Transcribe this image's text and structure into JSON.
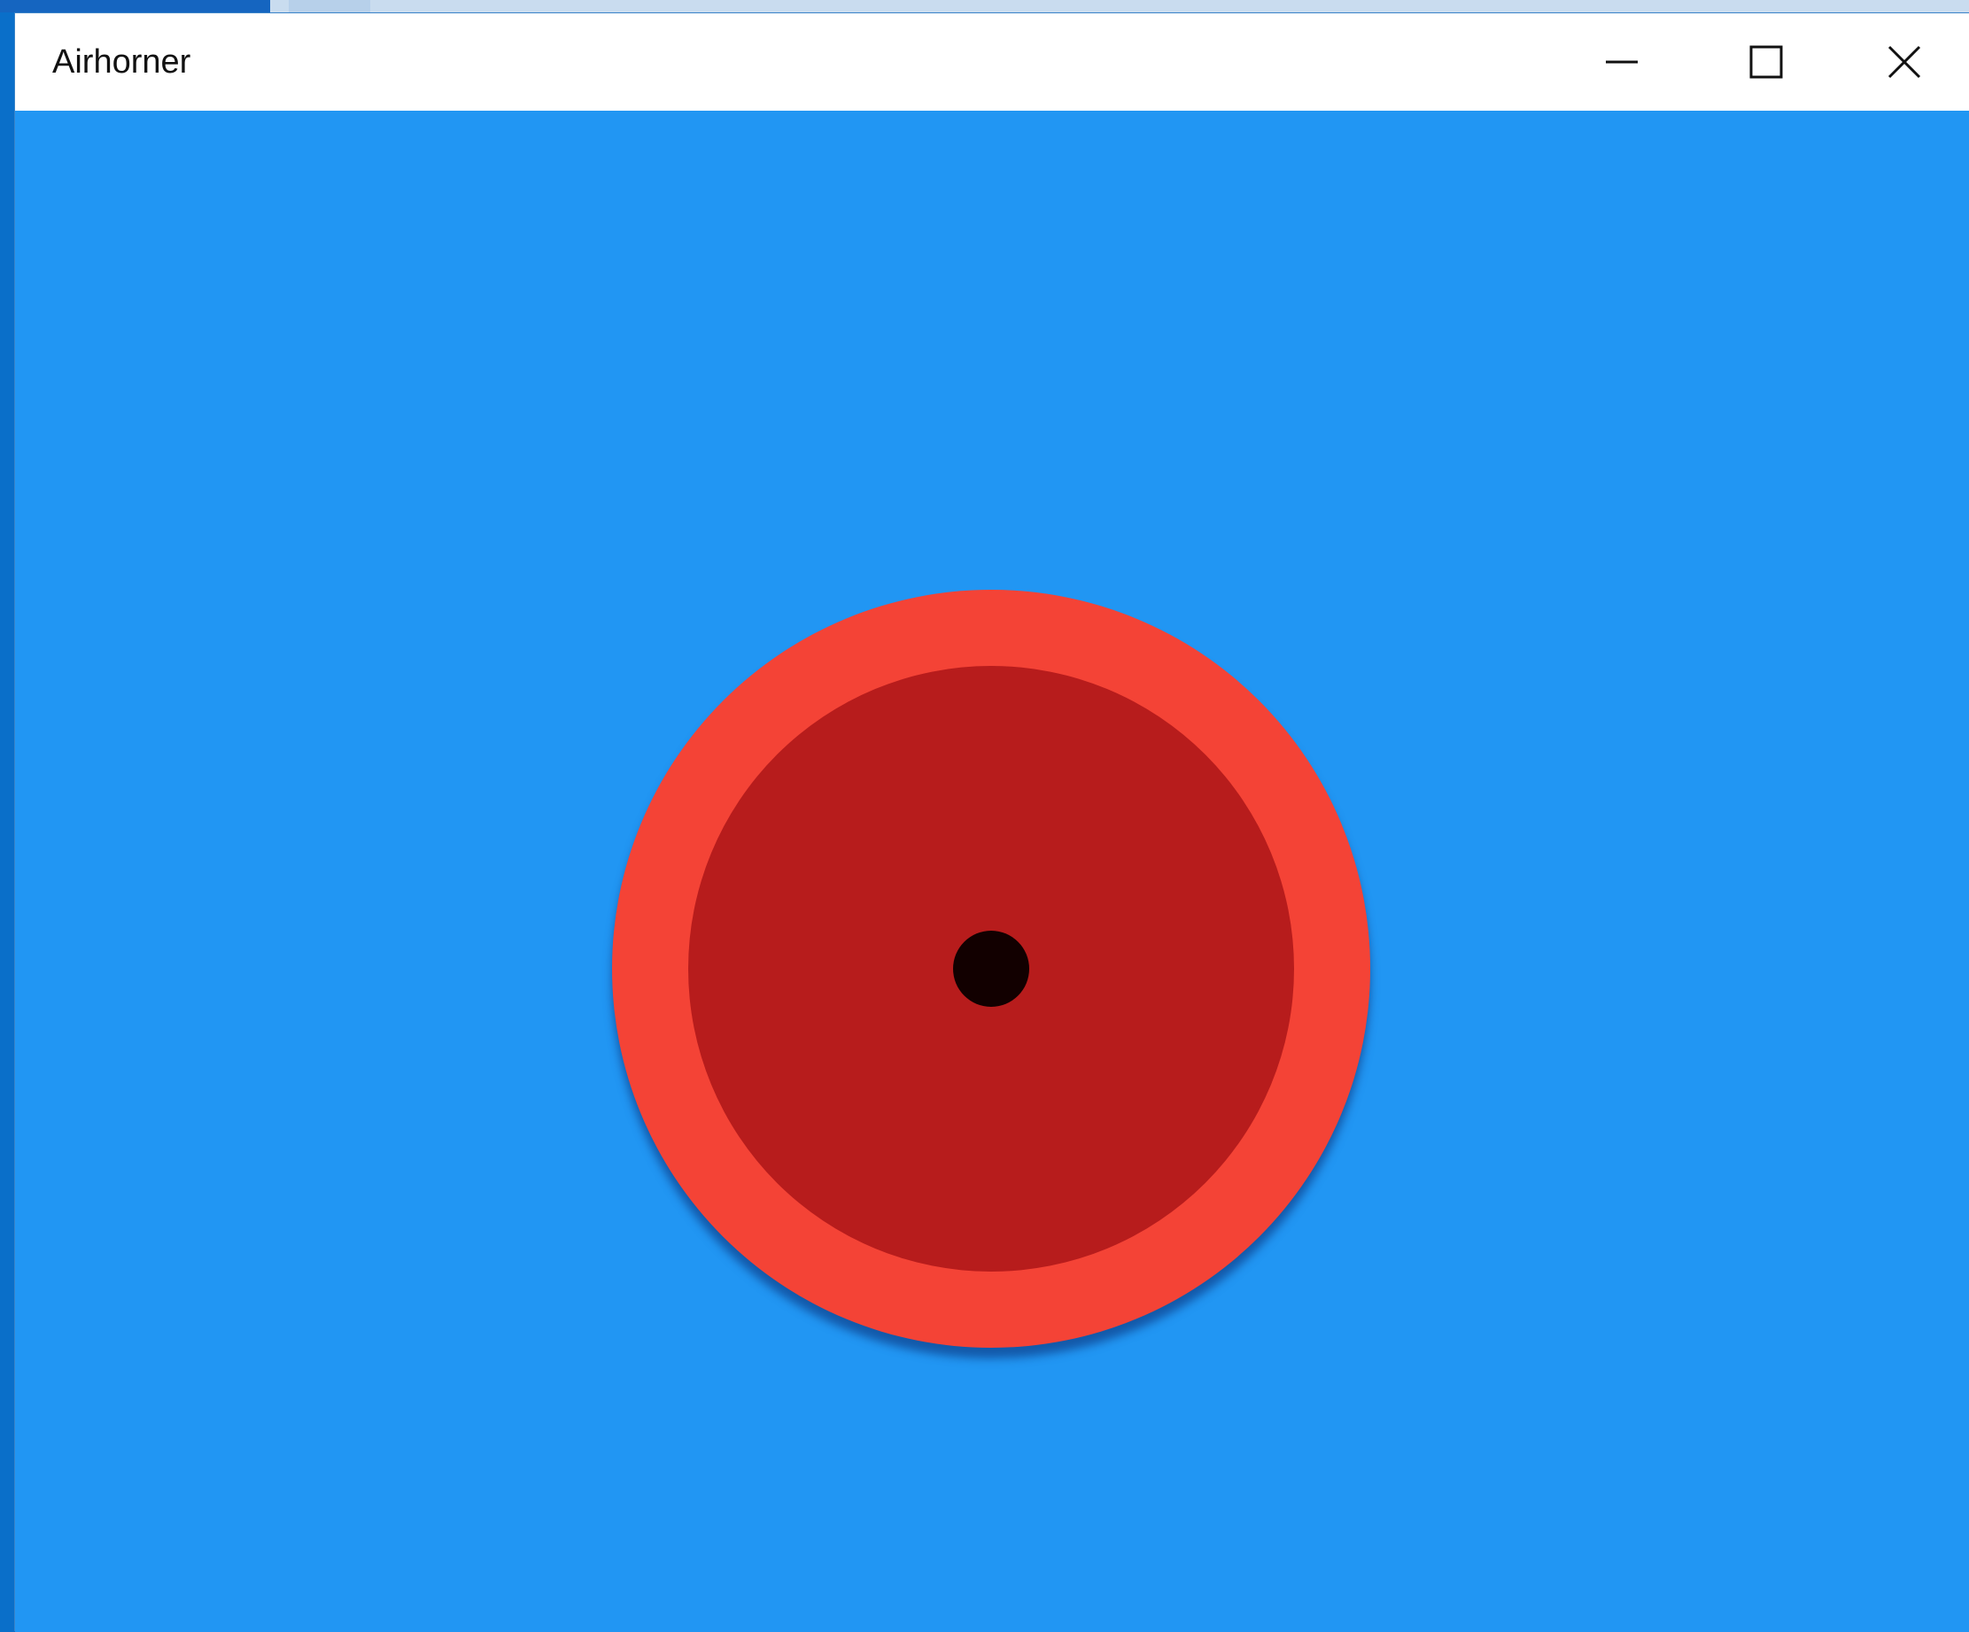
{
  "window": {
    "title": "Airhorner"
  },
  "titlebar": {
    "buttons": [
      {
        "name": "minimize",
        "icon": "minimize-icon"
      },
      {
        "name": "maximize",
        "icon": "maximize-icon"
      },
      {
        "name": "close",
        "icon": "close-icon"
      }
    ]
  },
  "colors": {
    "background": "#2196f3",
    "horn_outer": "#f44336",
    "horn_inner": "#b71c1c",
    "horn_center": "#120000",
    "titlebar": "#ffffff"
  }
}
